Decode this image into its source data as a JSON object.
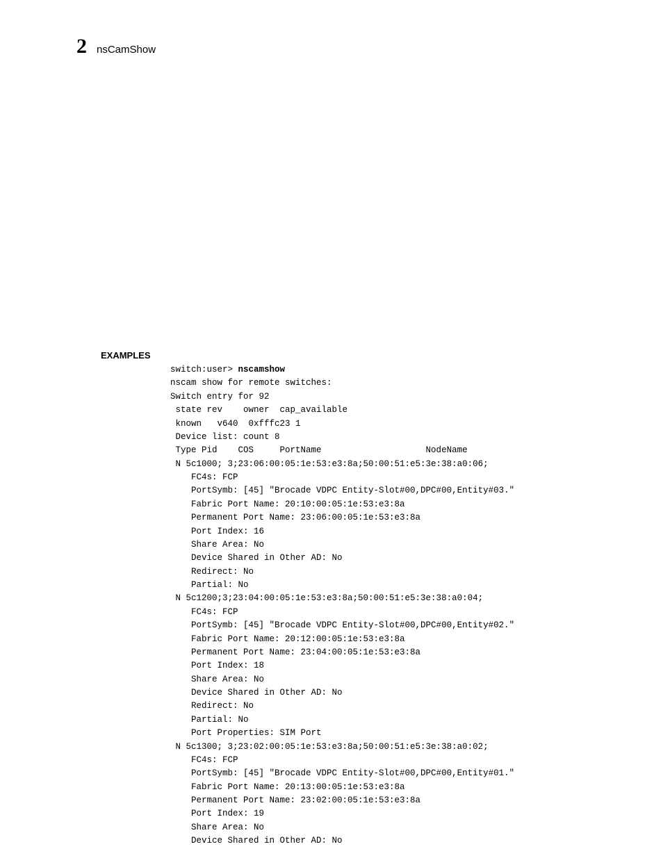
{
  "header": {
    "chapter": "2",
    "command": "nsCamShow"
  },
  "section": {
    "label": "EXAMPLES"
  },
  "terminal": {
    "prompt": "switch:user> ",
    "command": "nscamshow",
    "output": "nscam show for remote switches:\nSwitch entry for 92\n state rev    owner  cap_available\n known   v640  0xfffc23 1\n Device list: count 8\n Type Pid    COS     PortName                    NodeName\n N 5c1000; 3;23:06:00:05:1e:53:e3:8a;50:00:51:e5:3e:38:a0:06;\n    FC4s: FCP\n    PortSymb: [45] \"Brocade VDPC Entity-Slot#00,DPC#00,Entity#03.\"\n    Fabric Port Name: 20:10:00:05:1e:53:e3:8a\n    Permanent Port Name: 23:06:00:05:1e:53:e3:8a\n    Port Index: 16\n    Share Area: No\n    Device Shared in Other AD: No\n    Redirect: No\n    Partial: No\n N 5c1200;3;23:04:00:05:1e:53:e3:8a;50:00:51:e5:3e:38:a0:04;\n    FC4s: FCP\n    PortSymb: [45] \"Brocade VDPC Entity-Slot#00,DPC#00,Entity#02.\"\n    Fabric Port Name: 20:12:00:05:1e:53:e3:8a\n    Permanent Port Name: 23:04:00:05:1e:53:e3:8a\n    Port Index: 18\n    Share Area: No\n    Device Shared in Other AD: No\n    Redirect: No\n    Partial: No\n    Port Properties: SIM Port\n N 5c1300; 3;23:02:00:05:1e:53:e3:8a;50:00:51:e5:3e:38:a0:02;\n    FC4s: FCP\n    PortSymb: [45] \"Brocade VDPC Entity-Slot#00,DPC#00,Entity#01.\"\n    Fabric Port Name: 20:13:00:05:1e:53:e3:8a\n    Permanent Port Name: 23:02:00:05:1e:53:e3:8a\n    Port Index: 19\n    Share Area: No\n    Device Shared in Other AD: No"
  }
}
